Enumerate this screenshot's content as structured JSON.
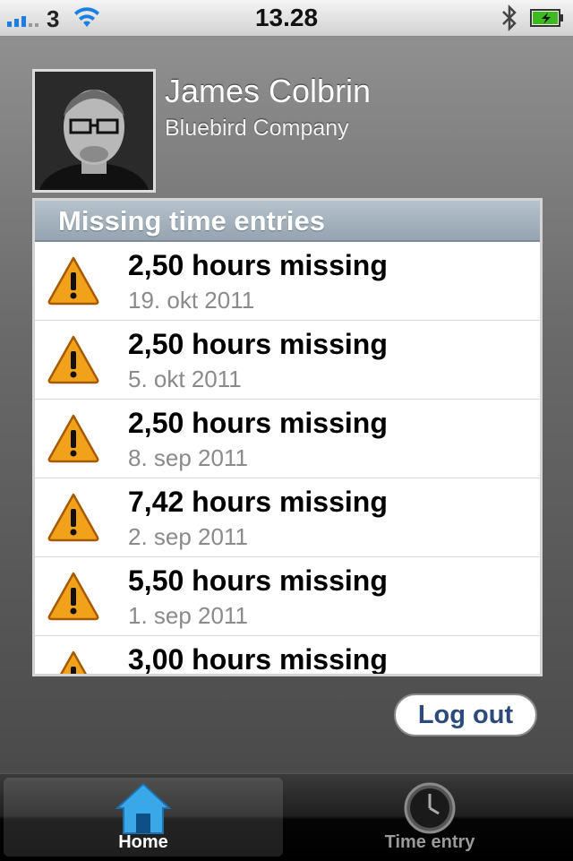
{
  "status_bar": {
    "carrier": "3",
    "time": "13.28",
    "colors": {
      "signal": "#1a7fe0",
      "battery": "#3dbb1e"
    }
  },
  "profile": {
    "name": "James Colbrin",
    "company": "Bluebird Company"
  },
  "missing_entries": {
    "header": "Missing time entries",
    "items": [
      {
        "title": "2,50 hours missing",
        "date": "19. okt 2011",
        "icon": "warning-icon"
      },
      {
        "title": "2,50 hours missing",
        "date": "5. okt 2011",
        "icon": "warning-icon"
      },
      {
        "title": "2,50 hours missing",
        "date": "8. sep 2011",
        "icon": "warning-icon"
      },
      {
        "title": "7,42 hours missing",
        "date": "2. sep 2011",
        "icon": "warning-icon"
      },
      {
        "title": "5,50 hours missing",
        "date": "1. sep 2011",
        "icon": "warning-icon"
      },
      {
        "title": "3,00 hours missing",
        "date": "",
        "icon": "warning-icon"
      }
    ]
  },
  "actions": {
    "logout_label": "Log out"
  },
  "tab_bar": {
    "tabs": [
      {
        "label": "Home",
        "icon": "home-icon",
        "selected": true
      },
      {
        "label": "Time entry",
        "icon": "clock-icon",
        "selected": false
      }
    ]
  }
}
